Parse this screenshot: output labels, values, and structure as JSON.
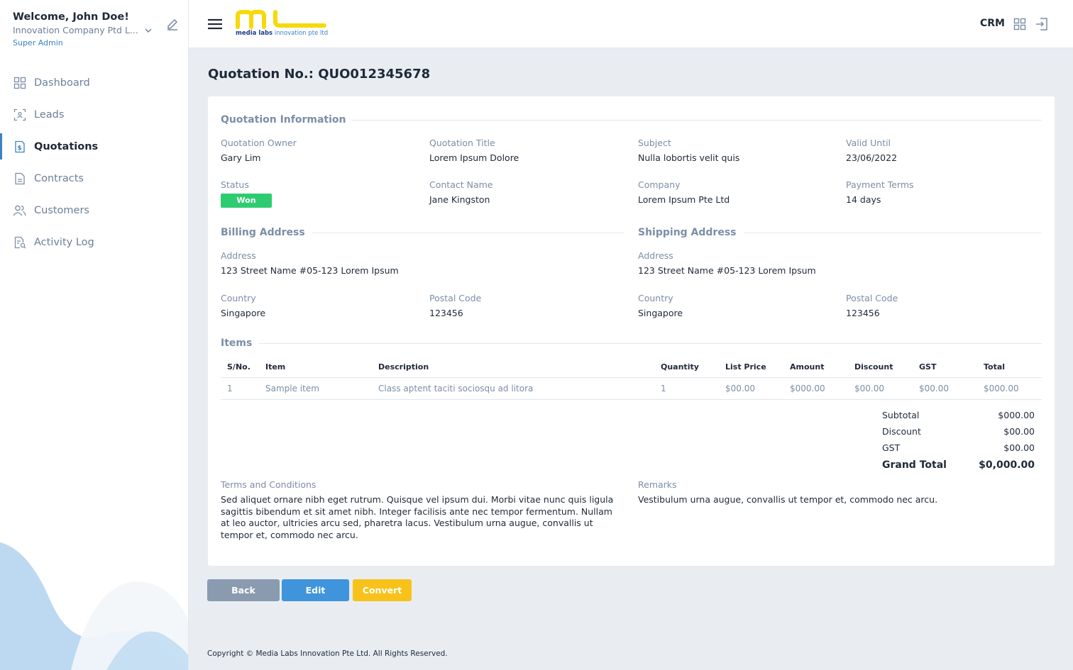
{
  "sidebar": {
    "welcome": "Welcome, John Doe!",
    "company": "Innovation Company Ptd L...",
    "role": "Super Admin",
    "items": [
      {
        "label": "Dashboard",
        "icon": "dashboard-icon"
      },
      {
        "label": "Leads",
        "icon": "leads-icon"
      },
      {
        "label": "Quotations",
        "icon": "quotations-icon",
        "active": true
      },
      {
        "label": "Contracts",
        "icon": "contracts-icon"
      },
      {
        "label": "Customers",
        "icon": "customers-icon"
      },
      {
        "label": "Activity Log",
        "icon": "activity-log-icon"
      }
    ]
  },
  "header": {
    "logo_text_bold": "media labs",
    "logo_text_rest": " innovation pte ltd",
    "crm": "CRM"
  },
  "page": {
    "title": "Quotation No.: QUO012345678"
  },
  "quotation_info": {
    "section_title": "Quotation Information",
    "owner_label": "Quotation Owner",
    "owner": "Gary Lim",
    "title_label": "Quotation Title",
    "title": "Lorem Ipsum Dolore",
    "subject_label": "Subject",
    "subject": "Nulla lobortis velit quis",
    "valid_label": "Valid Until",
    "valid": "23/06/2022",
    "status_label": "Status",
    "status": "Won",
    "contact_label": "Contact Name",
    "contact": "Jane Kingston",
    "company_label": "Company",
    "company": "Lorem Ipsum Pte Ltd",
    "payment_label": "Payment Terms",
    "payment": "14 days"
  },
  "billing": {
    "section_title": "Billing Address",
    "address_label": "Address",
    "address": "123 Street Name #05-123 Lorem Ipsum",
    "country_label": "Country",
    "country": "Singapore",
    "postal_label": "Postal Code",
    "postal": "123456"
  },
  "shipping": {
    "section_title": "Shipping Address",
    "address_label": "Address",
    "address": "123 Street Name #05-123 Lorem Ipsum",
    "country_label": "Country",
    "country": "Singapore",
    "postal_label": "Postal Code",
    "postal": "123456"
  },
  "items": {
    "section_title": "Items",
    "columns": [
      "S/No.",
      "Item",
      "Description",
      "Quantity",
      "List Price",
      "Amount",
      "Discount",
      "GST",
      "Total"
    ],
    "rows": [
      [
        "1",
        "Sample item",
        "Class aptent taciti sociosqu ad litora",
        "1",
        "$00.00",
        "$000.00",
        "$00.00",
        "$00.00",
        "$000.00"
      ]
    ]
  },
  "totals": {
    "subtotal_label": "Subtotal",
    "subtotal": "$000.00",
    "discount_label": "Discount",
    "discount": "$00.00",
    "gst_label": "GST",
    "gst": "$00.00",
    "grand_label": "Grand Total",
    "grand": "$0,000.00"
  },
  "terms": {
    "label": "Terms and Conditions",
    "text": "Sed aliquet ornare nibh eget rutrum. Quisque vel ipsum dui. Morbi vitae nunc quis ligula sagittis bibendum et sit amet nibh. Integer facilisis ante nec tempor fermentum. Nullam at leo auctor, ultricies arcu sed, pharetra lacus. Vestibulum urna augue, convallis ut tempor et, commodo nec arcu."
  },
  "remarks": {
    "label": "Remarks",
    "text": "Vestibulum urna augue, convallis ut tempor et, commodo nec arcu."
  },
  "buttons": {
    "back": "Back",
    "edit": "Edit",
    "convert": "Convert"
  },
  "footer": "Copyright © Media Labs Innovation Pte Ltd. All Rights Reserved.",
  "colors": {
    "accent": "#3b82c4",
    "success": "#2ecc71",
    "brand_yellow": "#f7d90a",
    "convert": "#f7c21a"
  }
}
